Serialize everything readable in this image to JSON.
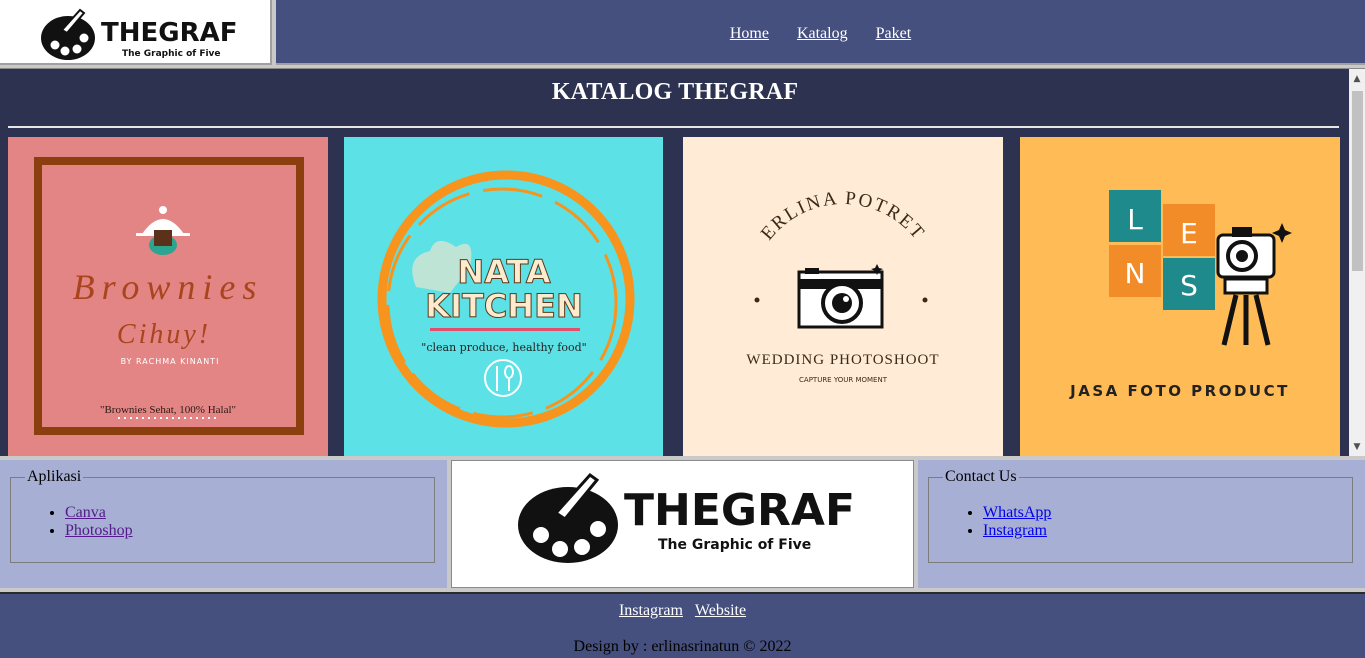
{
  "header": {
    "logo_text": "THEGRAF",
    "logo_subtitle": "The Graphic of Five",
    "nav": [
      "Home",
      "Katalog",
      "Paket"
    ]
  },
  "main": {
    "title": "KATALOG THEGRAF",
    "cards": [
      {
        "title": "Brownies",
        "subtitle": "Cihuy!",
        "byline": "BY RACHMA KINANTI",
        "tagline": "\"Brownies Sehat, 100% Halal\"",
        "bg": "#e38585"
      },
      {
        "title": "NATA",
        "title2": "KITCHEN",
        "tagline": "\"clean produce, healthy food\"",
        "bg": "#5ce1e6"
      },
      {
        "title": "ERLINA POTRET",
        "subtitle": "WEDDING PHOTOSHOOT",
        "tagline": "CAPTURE YOUR MOMENT",
        "bg": "#ffebd6"
      },
      {
        "letters": [
          "L",
          "E",
          "N",
          "S"
        ],
        "subtitle": "JASA FOTO PRODUCT",
        "bg": "#ffbb55"
      }
    ]
  },
  "aplikasi": {
    "legend": "Aplikasi",
    "items": [
      "Canva",
      "Photoshop"
    ]
  },
  "contact": {
    "legend": "Contact Us",
    "items": [
      "WhatsApp",
      "Instagram"
    ]
  },
  "footer": {
    "links": [
      "Instagram",
      "Website"
    ],
    "credit": "Design by : erlinasrinatun © 2022"
  },
  "colors": {
    "nav_bg": "#46507e",
    "main_bg": "#2d3250",
    "panel_bg": "#a7afd4"
  }
}
